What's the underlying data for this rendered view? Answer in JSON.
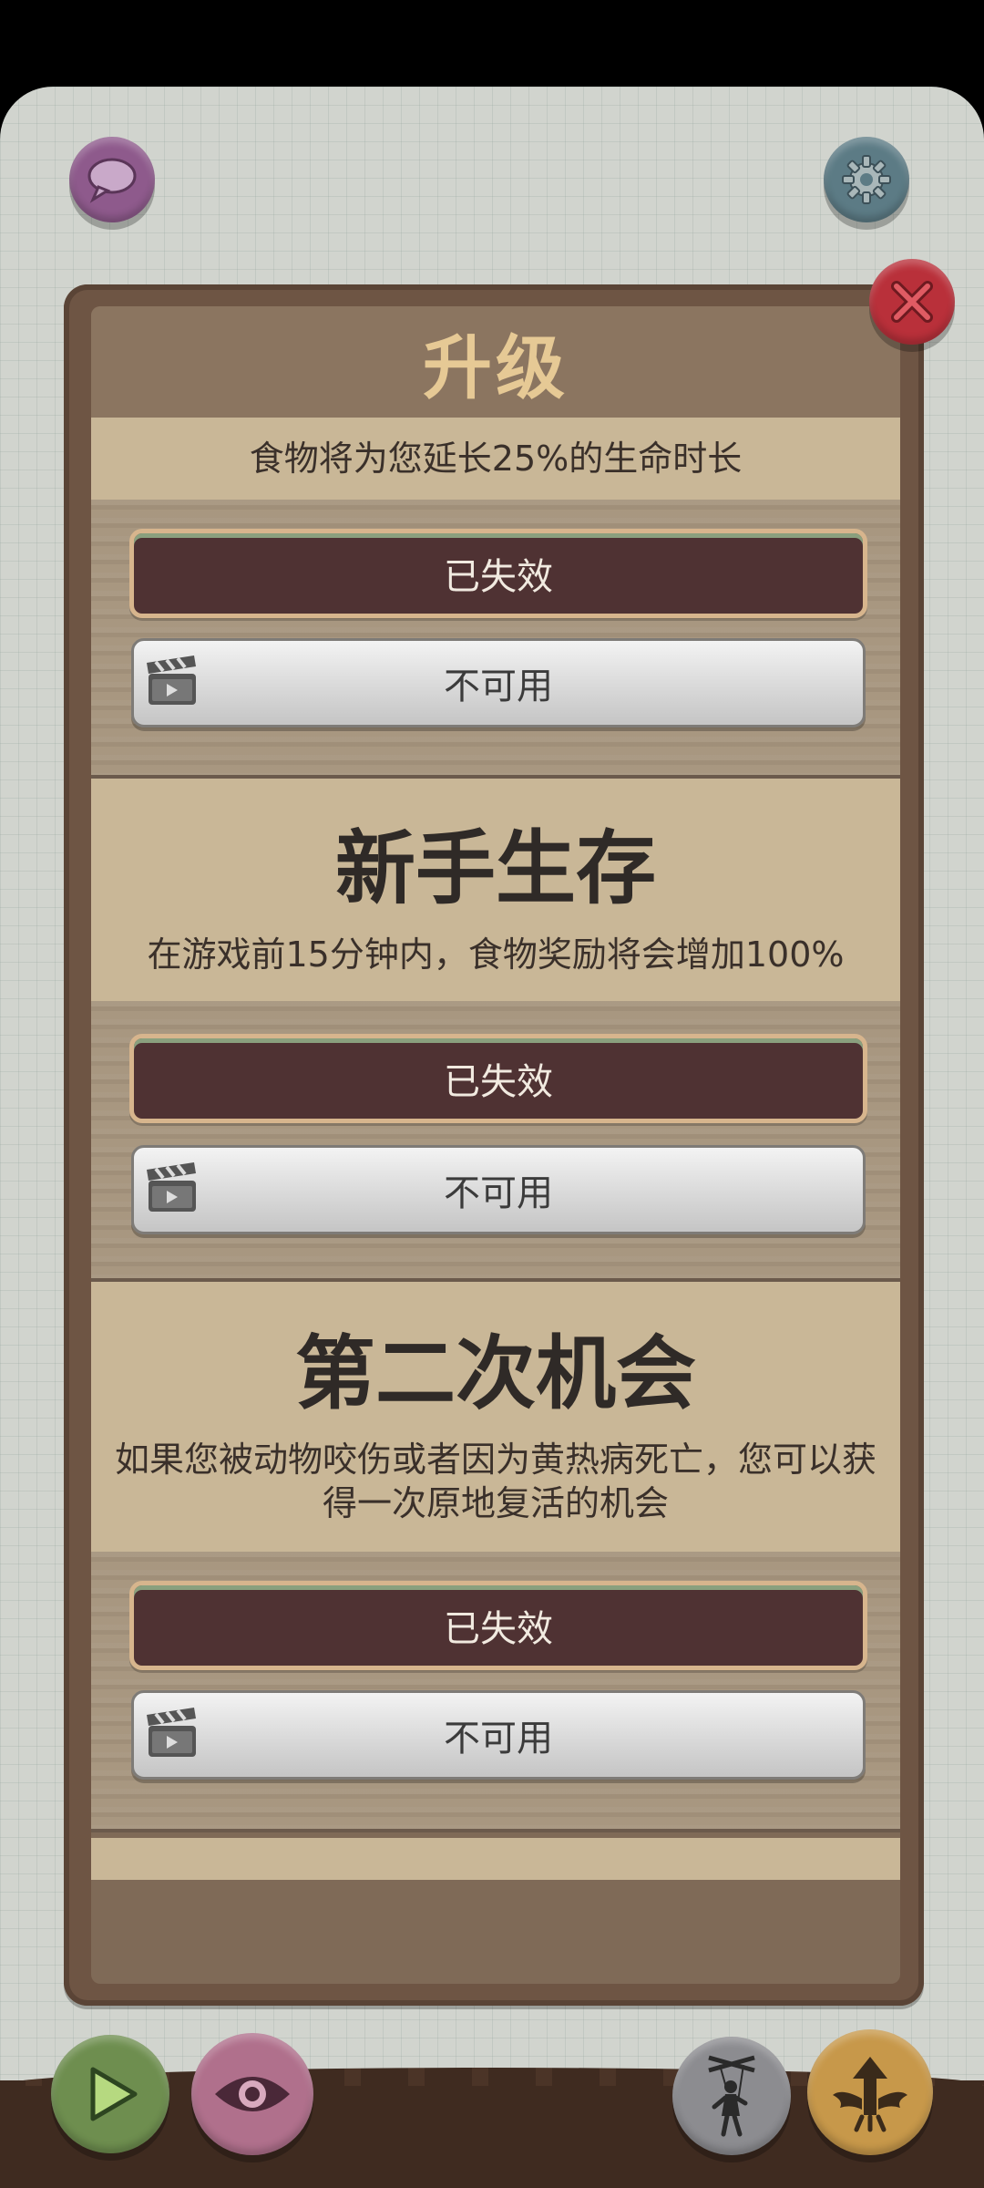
{
  "panel": {
    "title": "升级",
    "subtitle": "食物将为您延长25%的生命时长",
    "sections": [
      {
        "title": "新手生存",
        "description": "在游戏前15分钟内，食物奖励将会增加100%"
      },
      {
        "title": "第二次机会",
        "description": "如果您被动物咬伤或者因为黄热病死亡，您可以获得一次原地复活的机会"
      }
    ],
    "expired_label": "已失效",
    "unavailable_label": "不可用"
  },
  "icons": {
    "top_left": "chat-bubble-icon",
    "top_right": "gear-icon",
    "close": "close-icon",
    "clapperboard": "clapperboard-icon",
    "bottom": [
      "play-icon",
      "eye-icon",
      "puppet-icon",
      "wings-arrow-icon"
    ]
  },
  "colors": {
    "chat_button": "#8e5a8c",
    "settings_button": "#5c7b85",
    "close_button": "#b9303a",
    "play_button": "#6e8e4f",
    "eye_button": "#b0708c",
    "puppet_button": "#8c8c90",
    "evolve_button": "#c7984a"
  }
}
